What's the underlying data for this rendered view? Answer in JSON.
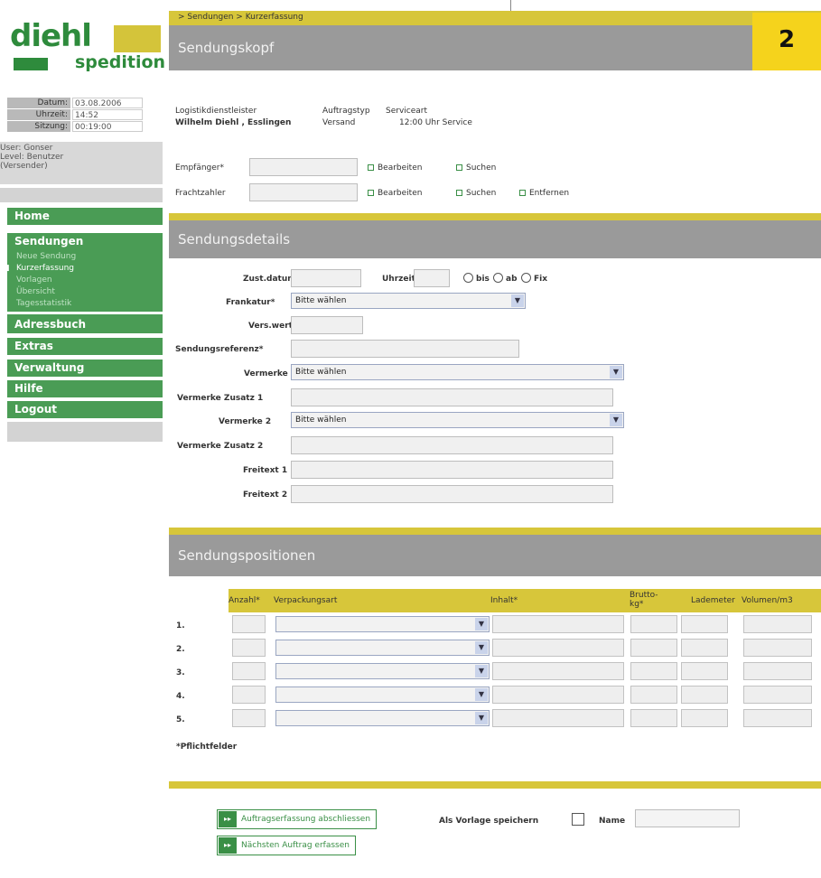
{
  "logo": {
    "main": "diehl",
    "sub": "spedition"
  },
  "info": {
    "date_label": "Datum:",
    "date_value": "03.08.2006",
    "time_label": "Uhrzeit:",
    "time_value": "14:52",
    "session_label": "Sitzung:",
    "session_value": "00:19:00"
  },
  "user": {
    "line1": "User: Gonser",
    "line2": "Level: Benutzer",
    "line3": "(Versender)"
  },
  "nav": {
    "home": "Home",
    "sendungen": "Sendungen",
    "sub": [
      "Neue Sendung",
      "Kurzerfassung",
      "Vorlagen",
      "Übersicht",
      "Tagesstatistik"
    ],
    "adressbuch": "Adressbuch",
    "extras": "Extras",
    "verwaltung": "Verwaltung",
    "hilfe": "Hilfe",
    "logout": "Logout"
  },
  "breadcrumb": "> Sendungen > Kurzerfassung",
  "badge": "2",
  "sections": {
    "kopf": "Sendungskopf",
    "details": "Sendungsdetails",
    "positionen": "Sendungspositionen"
  },
  "kopf": {
    "col1_label": "Logistikdienstleister",
    "col2_label": "Auftragstyp",
    "col3_label": "Serviceart",
    "col1_value": "Wilhelm Diehl , Esslingen",
    "col2_value": "Versand",
    "col3_value": "12:00 Uhr Service",
    "empfaenger_label": "Empfänger*",
    "frachtzahler_label": "Frachtzahler",
    "bearbeiten": "Bearbeiten",
    "suchen": "Suchen",
    "entfernen": "Entfernen"
  },
  "details": {
    "zust_label": "Zust.datum",
    "uhrzeit_label": "Uhrzeit",
    "bis": "bis",
    "ab": "ab",
    "fix": "Fix",
    "frankatur_label": "Frankatur*",
    "frankatur_value": "Bitte wählen",
    "vers_wert_label": "Vers.wert",
    "referenz_label": "Sendungsreferenz*",
    "vermerke_label": "Vermerke",
    "vermerke_value": "Bitte wählen",
    "vermerke_zusatz1_label": "Vermerke Zusatz 1",
    "vermerke2_label": "Vermerke 2",
    "vermerke2_value": "Bitte wählen",
    "vermerke_zusatz2_label": "Vermerke Zusatz 2",
    "freitext1_label": "Freitext 1",
    "freitext2_label": "Freitext 2"
  },
  "positionen": {
    "headers": [
      "Anzahl*",
      "Verpackungsart",
      "Inhalt*",
      "Brutto-",
      "kg*",
      "Lademeter",
      "Volumen/m3"
    ],
    "rows": [
      "1.",
      "2.",
      "3.",
      "4.",
      "5."
    ],
    "pflicht": "*Pflichtfelder"
  },
  "footer": {
    "abschliessen": "Auftragserfassung abschliessen",
    "vorlage_label": "Als Vorlage speichern",
    "name_label": "Name",
    "naechster": "Nächsten Auftrag erfassen",
    "btn_icon": "▸▸"
  }
}
